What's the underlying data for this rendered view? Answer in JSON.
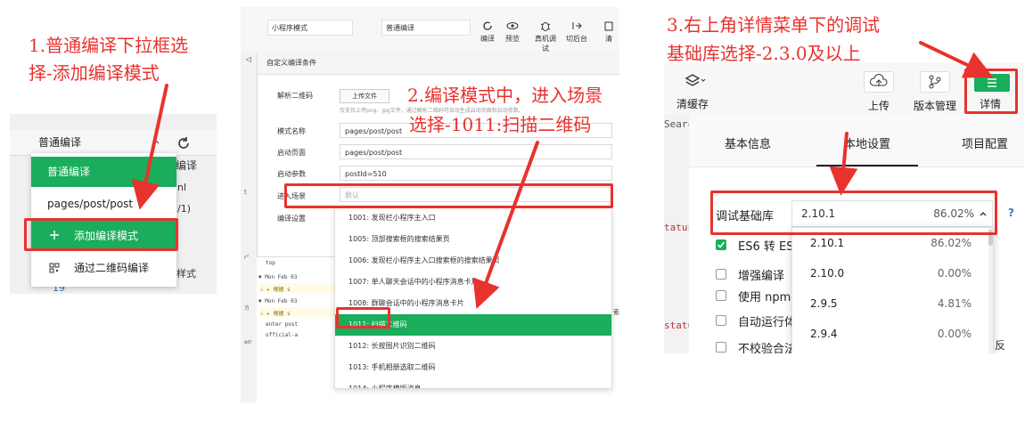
{
  "annotations": {
    "a1_line1": "1.普通编译下拉框选",
    "a1_line2": "择-添加编译模式",
    "a2_line1": "2.编译模式中，进入场景",
    "a2_line2": "选择-1011:扫描二维码",
    "a3_line1": "3.右上角详情菜单下的调试",
    "a3_line2": "基础库选择-2.3.0及以上"
  },
  "panel1": {
    "select_value": "普通编译",
    "side_fragment_top": "编译",
    "side_fragment_mid": "nl",
    "side_fragment_low1": "/1)",
    "side_fragment_low2": "样式",
    "line_number": "19",
    "menu": {
      "item_normal": "普通编译",
      "item_page": "pages/post/post",
      "item_add": "添加编译模式",
      "item_add_icon": "plus-icon",
      "item_qr": "通过二维码编译",
      "item_qr_icon": "qrcode-icon"
    }
  },
  "panel2": {
    "mode_select": "小程序模式",
    "compile_select": "普通编译",
    "tools": [
      "编译",
      "预览",
      "真机调试",
      "切后台",
      "清"
    ],
    "dialog_title": "自定义编译条件",
    "fields": {
      "parse_qr_label": "解析二维码",
      "upload_button": "上传文件",
      "upload_hint": "仅支持上传png、jpg文件，通过解析二维码可自动生成启动页面和启动参数。",
      "mode_name_label": "模式名称",
      "mode_name_value": "pages/post/post",
      "start_page_label": "启动页面",
      "start_page_value": "pages/post/post",
      "start_params_label": "启动参数",
      "start_params_value": "postId=510",
      "scene_label": "进入场景",
      "scene_placeholder": "默认",
      "compile_settings_label": "编译设置"
    },
    "scene_options": [
      "1001: 发现栏小程序主入口",
      "1005: 顶部搜索框的搜索结果页",
      "1006: 发现栏小程序主入口搜索框的搜索结果页",
      "1007: 单人聊天会话中的小程序消息卡片",
      "1008: 群聊会话中的小程序消息卡片",
      "1011: 扫描二维码",
      "1012: 长按图片识别二维码",
      "1013: 手机相册选取二维码",
      "1014: 小程序模版消息"
    ],
    "console": {
      "tab": "top",
      "line1": "▼ Mon Feb 03",
      "line2": "⚠ ▸ 根据 s",
      "line3": "▼ Mon Feb 03",
      "line4": "⚠ ▸ 根据 s",
      "line5": "enter post",
      "line6": "official-a",
      "right_fragment": "索"
    },
    "side": [
      "f.",
      "r\"",
      "方",
      "err"
    ]
  },
  "panel3": {
    "toolbar": {
      "clear_cache": "清缓存",
      "upload": "上传",
      "version": "版本管理",
      "details": "详情"
    },
    "left_fragments": [
      "Searc",
      "tatus",
      "statu"
    ],
    "tabs": [
      "基本信息",
      "本地设置",
      "项目配置"
    ],
    "base_lib_label": "调试基础库",
    "base_lib_value": "2.10.1",
    "base_lib_pct": "86.02%",
    "help": "?",
    "versions": [
      {
        "v": "2.10.1",
        "p": "86.02%"
      },
      {
        "v": "2.10.0",
        "p": "0.00%"
      },
      {
        "v": "2.9.5",
        "p": "4.81%"
      },
      {
        "v": "2.9.4",
        "p": "0.00%"
      }
    ],
    "checks": [
      {
        "label": "ES6 转 ES",
        "on": true
      },
      {
        "label": "增强编译",
        "on": false
      },
      {
        "label": "使用 npm 模",
        "on": false
      },
      {
        "label": "自动运行体",
        "on": false
      },
      {
        "label": "不校验合法",
        "on": false
      }
    ],
    "trailing_fragment": "反"
  },
  "colors": {
    "accent": "#1aad5c",
    "annotation": "#e8322e"
  }
}
